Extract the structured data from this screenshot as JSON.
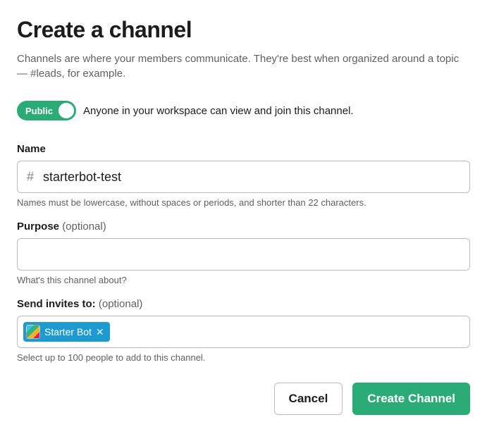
{
  "title": "Create a channel",
  "description": "Channels are where your members communicate. They're best when organized around a topic — #leads, for example.",
  "toggle": {
    "label": "Public",
    "description": "Anyone in your workspace can view and join this channel."
  },
  "name": {
    "label": "Name",
    "prefix": "#",
    "value": "starterbot-test",
    "help": "Names must be lowercase, without spaces or periods, and shorter than 22 characters."
  },
  "purpose": {
    "label": "Purpose",
    "optional": "(optional)",
    "value": "",
    "help": "What's this channel about?"
  },
  "invites": {
    "label": "Send invites to:",
    "optional": "(optional)",
    "pills": [
      {
        "name": "Starter Bot"
      }
    ],
    "help": "Select up to 100 people to add to this channel."
  },
  "actions": {
    "cancel": "Cancel",
    "create": "Create Channel"
  }
}
